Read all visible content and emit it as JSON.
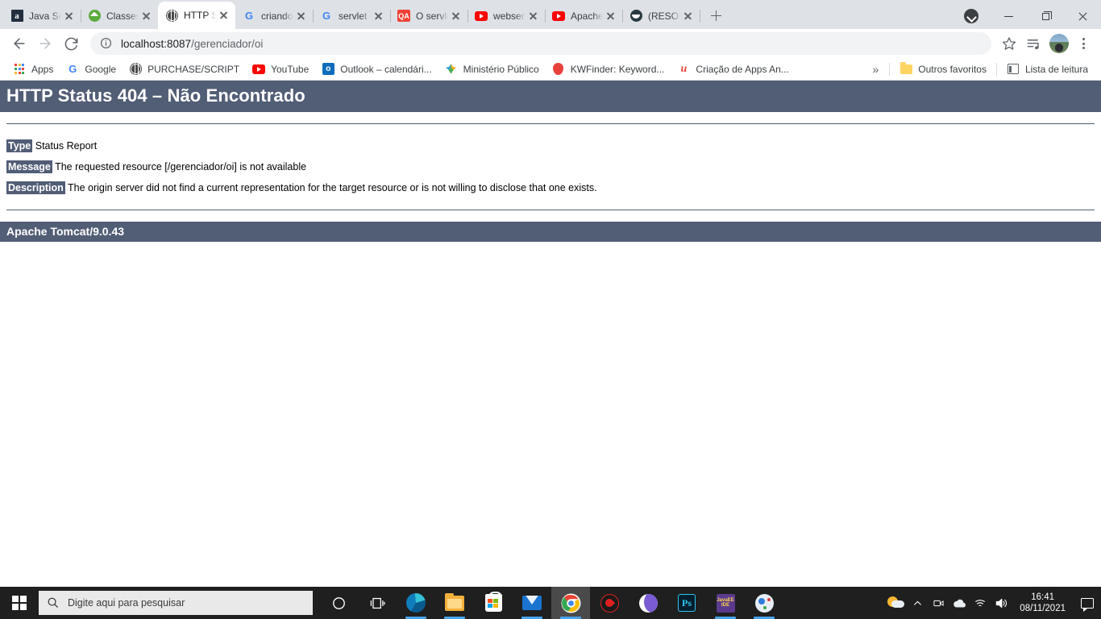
{
  "browser": {
    "tabs": [
      {
        "title": "Java Servle",
        "icon": "amazon-icon",
        "active": false
      },
      {
        "title": "Classes de",
        "icon": "green-diamond-icon",
        "active": false
      },
      {
        "title": "HTTP Statu",
        "icon": "globe-icon",
        "active": true
      },
      {
        "title": "criando o p",
        "icon": "google-icon",
        "active": false
      },
      {
        "title": "servlet não",
        "icon": "google-icon",
        "active": false
      },
      {
        "title": "O servlet r",
        "icon": "qa-icon",
        "active": false
      },
      {
        "title": "webservlet",
        "icon": "youtube-icon",
        "active": false
      },
      {
        "title": "Apache To",
        "icon": "youtube-icon",
        "active": false
      },
      {
        "title": "(RESOLVID",
        "icon": "smiley-icon",
        "active": false
      }
    ],
    "new_tab_label": "+",
    "window_controls": {
      "download_label": "",
      "minimize_label": "",
      "maximize_label": "",
      "close_label": ""
    },
    "toolbar": {
      "back_label": "",
      "forward_label": "",
      "reload_label": "",
      "url_scheme": "",
      "url_host": "localhost:8087",
      "url_path": "/gerenciador/oi",
      "url_full": "localhost:8087/gerenciador/oi",
      "star_label": "",
      "media_label": "",
      "profile_label": "",
      "menu_label": ""
    },
    "bookmarks": [
      {
        "label": "Apps",
        "icon": "apps-grid-icon"
      },
      {
        "label": "Google",
        "icon": "google-icon"
      },
      {
        "label": "PURCHASE/SCRIPT",
        "icon": "globe-icon"
      },
      {
        "label": "YouTube",
        "icon": "youtube-icon"
      },
      {
        "label": "Outlook – calendári...",
        "icon": "outlook-icon"
      },
      {
        "label": "Ministério Público",
        "icon": "ministerio-icon"
      },
      {
        "label": "KWFinder: Keyword...",
        "icon": "kwfinder-icon"
      },
      {
        "label": "Criação de Apps An...",
        "icon": "udemy-icon"
      }
    ],
    "bookmarks_overflow": "»",
    "other_bookmarks": "Outros favoritos",
    "reading_list": "Lista de leitura"
  },
  "page": {
    "title": "HTTP Status 404 – Não Encontrado",
    "type_label": "Type",
    "type_value": "Status Report",
    "message_label": "Message",
    "message_value": "The requested resource [/gerenciador/oi] is not available",
    "description_label": "Description",
    "description_value": "The origin server did not find a current representation for the target resource or is not willing to disclose that one exists.",
    "footer": "Apache Tomcat/9.0.43",
    "accent_color": "#525D76"
  },
  "taskbar": {
    "start_label": "",
    "search_placeholder": "Digite aqui para pesquisar",
    "apps": [
      {
        "name": "task-view",
        "running": false,
        "focused": false
      },
      {
        "name": "microsoft-edge",
        "running": true,
        "focused": false
      },
      {
        "name": "file-explorer",
        "running": true,
        "focused": false
      },
      {
        "name": "microsoft-store",
        "running": false,
        "focused": false
      },
      {
        "name": "mail",
        "running": true,
        "focused": false
      },
      {
        "name": "google-chrome",
        "running": true,
        "focused": true
      },
      {
        "name": "red-app",
        "running": false,
        "focused": false
      },
      {
        "name": "purple-moon-app",
        "running": false,
        "focused": false
      },
      {
        "name": "photoshop",
        "running": false,
        "focused": false
      },
      {
        "name": "javaee-ide",
        "running": true,
        "focused": false
      },
      {
        "name": "paint",
        "running": true,
        "focused": false
      }
    ],
    "tray": {
      "weather_label": "",
      "overflow_label": "^",
      "camera_label": "",
      "onedrive_label": "",
      "network_label": "",
      "volume_label": ""
    },
    "clock_time": "16:41",
    "clock_date": "08/11/2021",
    "action_center_label": ""
  }
}
